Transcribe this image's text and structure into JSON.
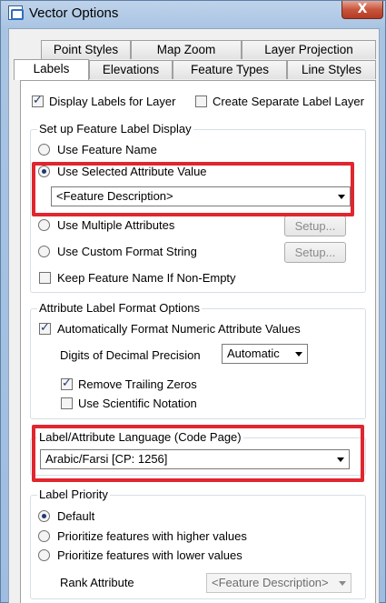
{
  "window": {
    "title": "Vector Options",
    "close_symbol": "X"
  },
  "tabs": {
    "row_back": [
      "Point Styles",
      "Map Zoom",
      "Layer Projection"
    ],
    "row_front": [
      "Labels",
      "Elevations",
      "Feature Types",
      "Line Styles"
    ],
    "active": "Labels"
  },
  "top_options": {
    "display_labels": {
      "label": "Display Labels for Layer",
      "checked": true
    },
    "separate_layer": {
      "label": "Create Separate Label Layer",
      "checked": false
    }
  },
  "feature_label_group": {
    "title": "Set up Feature Label Display",
    "use_feature_name": "Use Feature Name",
    "use_selected_attribute": "Use Selected Attribute Value",
    "attribute_select_value": "<Feature Description>",
    "use_multiple_attributes": "Use Multiple Attributes",
    "use_custom_format": "Use Custom Format String",
    "setup_label": "Setup...",
    "keep_feature_name": "Keep Feature Name If Non-Empty",
    "selected_option": "use_selected_attribute"
  },
  "format_group": {
    "title": "Attribute Label Format Options",
    "auto_format": {
      "label": "Automatically Format Numeric Attribute Values",
      "checked": true
    },
    "decimal_precision_label": "Digits of Decimal Precision",
    "decimal_precision_value": "Automatic",
    "remove_trailing_zeros": {
      "label": "Remove Trailing Zeros",
      "checked": true
    },
    "scientific_notation": {
      "label": "Use Scientific Notation",
      "checked": false
    }
  },
  "language_group": {
    "title": "Label/Attribute Language (Code Page)",
    "value": "Arabic/Farsi [CP: 1256]"
  },
  "priority_group": {
    "title": "Label Priority",
    "default": "Default",
    "higher": "Prioritize features with higher values",
    "lower": "Prioritize features with lower values",
    "rank_attribute_label": "Rank Attribute",
    "rank_attribute_value": "<Feature Description>",
    "selected_option": "default"
  },
  "colors": {
    "highlight": "#e0262e",
    "check": "#1e3a6e"
  }
}
